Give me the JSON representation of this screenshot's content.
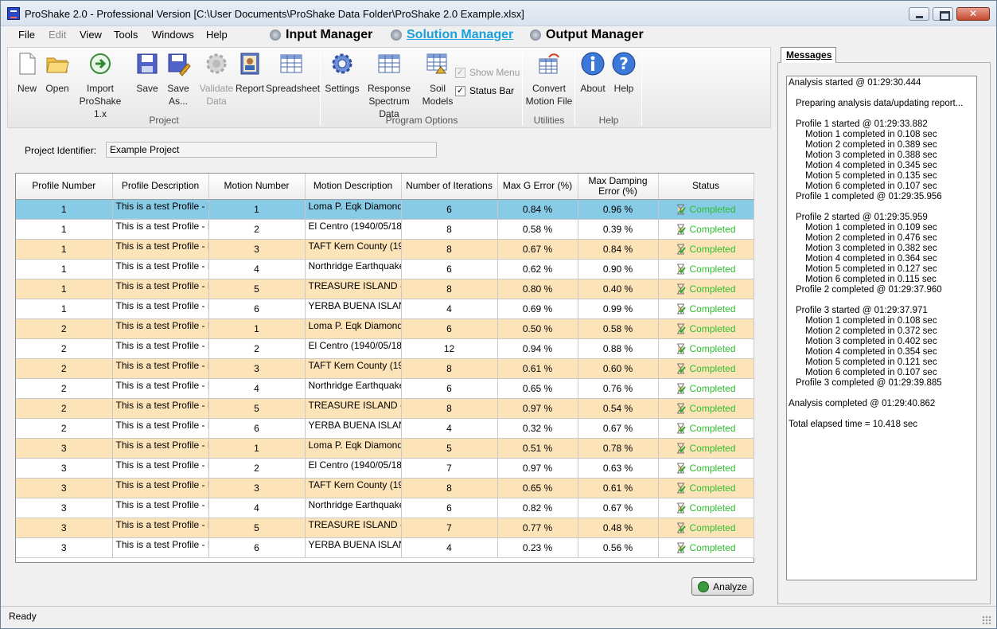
{
  "window": {
    "title": "ProShake 2.0 - Professional Version [C:\\User           Documents\\ProShake Data Folder\\ProShake 2.0 Example.xlsx]"
  },
  "menu": [
    "File",
    "Edit",
    "View",
    "Tools",
    "Windows",
    "Help"
  ],
  "managers": {
    "input": "Input Manager",
    "solution": "Solution Manager",
    "output": "Output Manager"
  },
  "toolbar": {
    "new": "New",
    "open": "Open",
    "import_l1": "Import",
    "import_l2": "ProShake 1.x",
    "save": "Save",
    "saveas_l1": "Save",
    "saveas_l2": "As...",
    "validate_l1": "Validate",
    "validate_l2": "Data",
    "report": "Report",
    "spreadsheet": "Spreadsheet",
    "settings": "Settings",
    "response_l1": "Response",
    "response_l2": "Spectrum Data",
    "soil_l1": "Soil",
    "soil_l2": "Models",
    "show_menu": "Show Menu",
    "status_bar": "Status Bar",
    "convert_l1": "Convert",
    "convert_l2": "Motion File",
    "about": "About",
    "help": "Help",
    "group_project": "Project",
    "group_program_options": "Program Options",
    "group_utilities": "Utilities",
    "group_help": "Help"
  },
  "project": {
    "label": "Project Identifier:",
    "value": "Example Project"
  },
  "table": {
    "headers": [
      "Profile Number",
      "Profile Description",
      "Motion Number",
      "Motion Description",
      "Number of Iterations",
      "Max G Error (%)",
      "Max Damping Error (%)",
      "Status"
    ],
    "rows": [
      [
        "1",
        "This is a test Profile - P",
        "1",
        "Loma P. Eqk Diamond",
        "6",
        "0.84 %",
        "0.96 %",
        "Completed"
      ],
      [
        "1",
        "This is a test Profile - P",
        "2",
        "El Centro (1940/05/18)",
        "8",
        "0.58 %",
        "0.39 %",
        "Completed"
      ],
      [
        "1",
        "This is a test Profile - P",
        "3",
        "TAFT Kern County (19",
        "8",
        "0.67 %",
        "0.84 %",
        "Completed"
      ],
      [
        "1",
        "This is a test Profile - P",
        "4",
        "Northridge Earthquake",
        "6",
        "0.62 %",
        "0.90 %",
        "Completed"
      ],
      [
        "1",
        "This is a test Profile - P",
        "5",
        "TREASURE ISLAND -",
        "8",
        "0.80 %",
        "0.40 %",
        "Completed"
      ],
      [
        "1",
        "This is a test Profile - P",
        "6",
        "YERBA BUENA ISLAN",
        "4",
        "0.69 %",
        "0.99 %",
        "Completed"
      ],
      [
        "2",
        "This is a test Profile - P",
        "1",
        "Loma P. Eqk Diamond",
        "6",
        "0.50 %",
        "0.58 %",
        "Completed"
      ],
      [
        "2",
        "This is a test Profile - P",
        "2",
        "El Centro (1940/05/18)",
        "12",
        "0.94 %",
        "0.88 %",
        "Completed"
      ],
      [
        "2",
        "This is a test Profile - P",
        "3",
        "TAFT Kern County (19",
        "8",
        "0.61 %",
        "0.60 %",
        "Completed"
      ],
      [
        "2",
        "This is a test Profile - P",
        "4",
        "Northridge Earthquake",
        "6",
        "0.65 %",
        "0.76 %",
        "Completed"
      ],
      [
        "2",
        "This is a test Profile - P",
        "5",
        "TREASURE ISLAND -",
        "8",
        "0.97 %",
        "0.54 %",
        "Completed"
      ],
      [
        "2",
        "This is a test Profile - P",
        "6",
        "YERBA BUENA ISLAN",
        "4",
        "0.32 %",
        "0.67 %",
        "Completed"
      ],
      [
        "3",
        "This is a test Profile - P",
        "1",
        "Loma P. Eqk Diamond",
        "5",
        "0.51 %",
        "0.78 %",
        "Completed"
      ],
      [
        "3",
        "This is a test Profile - P",
        "2",
        "El Centro (1940/05/18)",
        "7",
        "0.97 %",
        "0.63 %",
        "Completed"
      ],
      [
        "3",
        "This is a test Profile - P",
        "3",
        "TAFT Kern County (19",
        "8",
        "0.65 %",
        "0.61 %",
        "Completed"
      ],
      [
        "3",
        "This is a test Profile - P",
        "4",
        "Northridge Earthquake",
        "6",
        "0.82 %",
        "0.67 %",
        "Completed"
      ],
      [
        "3",
        "This is a test Profile - P",
        "5",
        "TREASURE ISLAND -",
        "7",
        "0.77 %",
        "0.48 %",
        "Completed"
      ],
      [
        "3",
        "This is a test Profile - P",
        "6",
        "YERBA BUENA ISLAN",
        "4",
        "0.23 %",
        "0.56 %",
        "Completed"
      ]
    ]
  },
  "analyze_label": "Analyze",
  "messages": {
    "tab": "Messages",
    "lines": [
      {
        "indent": 0,
        "text": "Analysis started @ 01:29:30.444"
      },
      {
        "indent": -1,
        "text": ""
      },
      {
        "indent": 1,
        "text": "Preparing analysis data/updating report..."
      },
      {
        "indent": -1,
        "text": ""
      },
      {
        "indent": 1,
        "text": "Profile 1 started @ 01:29:33.882"
      },
      {
        "indent": 2,
        "text": "Motion 1 completed in 0.108 sec"
      },
      {
        "indent": 2,
        "text": "Motion 2 completed in 0.389 sec"
      },
      {
        "indent": 2,
        "text": "Motion 3 completed in 0.388 sec"
      },
      {
        "indent": 2,
        "text": "Motion 4 completed in 0.345 sec"
      },
      {
        "indent": 2,
        "text": "Motion 5 completed in 0.135 sec"
      },
      {
        "indent": 2,
        "text": "Motion 6 completed in 0.107 sec"
      },
      {
        "indent": 1,
        "text": "Profile 1 completed @ 01:29:35.956"
      },
      {
        "indent": -1,
        "text": ""
      },
      {
        "indent": 1,
        "text": "Profile 2 started @ 01:29:35.959"
      },
      {
        "indent": 2,
        "text": "Motion 1 completed in 0.109 sec"
      },
      {
        "indent": 2,
        "text": "Motion 2 completed in 0.476 sec"
      },
      {
        "indent": 2,
        "text": "Motion 3 completed in 0.382 sec"
      },
      {
        "indent": 2,
        "text": "Motion 4 completed in 0.364 sec"
      },
      {
        "indent": 2,
        "text": "Motion 5 completed in 0.127 sec"
      },
      {
        "indent": 2,
        "text": "Motion 6 completed in 0.115 sec"
      },
      {
        "indent": 1,
        "text": "Profile 2 completed @ 01:29:37.960"
      },
      {
        "indent": -1,
        "text": ""
      },
      {
        "indent": 1,
        "text": "Profile 3 started @ 01:29:37.971"
      },
      {
        "indent": 2,
        "text": "Motion 1 completed in 0.108 sec"
      },
      {
        "indent": 2,
        "text": "Motion 2 completed in 0.372 sec"
      },
      {
        "indent": 2,
        "text": "Motion 3 completed in 0.402 sec"
      },
      {
        "indent": 2,
        "text": "Motion 4 completed in 0.354 sec"
      },
      {
        "indent": 2,
        "text": "Motion 5 completed in 0.121 sec"
      },
      {
        "indent": 2,
        "text": "Motion 6 completed in 0.107 sec"
      },
      {
        "indent": 1,
        "text": "Profile 3 completed @ 01:29:39.885"
      },
      {
        "indent": -1,
        "text": ""
      },
      {
        "indent": 0,
        "text": "Analysis completed @ 01:29:40.862"
      },
      {
        "indent": -1,
        "text": ""
      },
      {
        "indent": 0,
        "text": "Total elapsed time = 10.418 sec"
      }
    ]
  },
  "status_bar": "Ready",
  "colors": {
    "selected_row": "#87cbe6",
    "alt_row": "#fde3b8",
    "completed_text": "#2fbe2f",
    "active_manager": "#1aa0dc"
  }
}
